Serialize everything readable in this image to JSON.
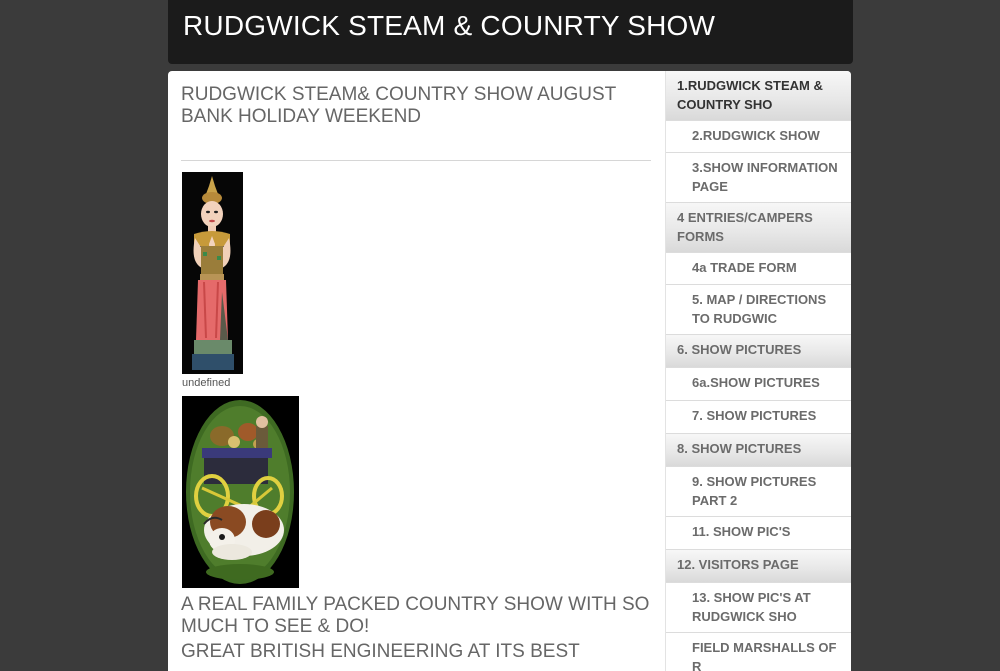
{
  "header": {
    "site_title": "RUDGWICK STEAM & COUNRTY SHOW"
  },
  "main": {
    "heading": "RUDGWICK STEAM& COUNTRY SHOW AUGUST BANK HOLIDAY WEEKEND",
    "image_caption": "undefined",
    "tagline": "A REAL FAMILY PACKED COUNTRY SHOW WITH SO MUCH TO SEE & DO!",
    "tagline2": "GREAT BRITISH ENGINEERING AT ITS BEST"
  },
  "sidebar": {
    "items": [
      {
        "label": "1.RUDGWICK STEAM & COUNTRY SHO"
      },
      {
        "label": "2.RUDGWICK SHOW"
      },
      {
        "label": "3.SHOW INFORMATION PAGE"
      },
      {
        "label": "4 ENTRIES/CAMPERS FORMS"
      },
      {
        "label": "4a TRADE FORM"
      },
      {
        "label": "5. MAP / DIRECTIONS TO RUDGWIC"
      },
      {
        "label": "6. SHOW PICTURES"
      },
      {
        "label": "6a.SHOW PICTURES"
      },
      {
        "label": "7. SHOW PICTURES"
      },
      {
        "label": "8. SHOW PICTURES"
      },
      {
        "label": "9. SHOW PICTURES PART 2"
      },
      {
        "label": "11. SHOW PIC'S"
      },
      {
        "label": "12. VISITORS PAGE"
      },
      {
        "label": "13. SHOW PIC'S AT RUDGWICK SHO"
      },
      {
        "label": "FIELD MARSHALLS OF R"
      }
    ]
  }
}
